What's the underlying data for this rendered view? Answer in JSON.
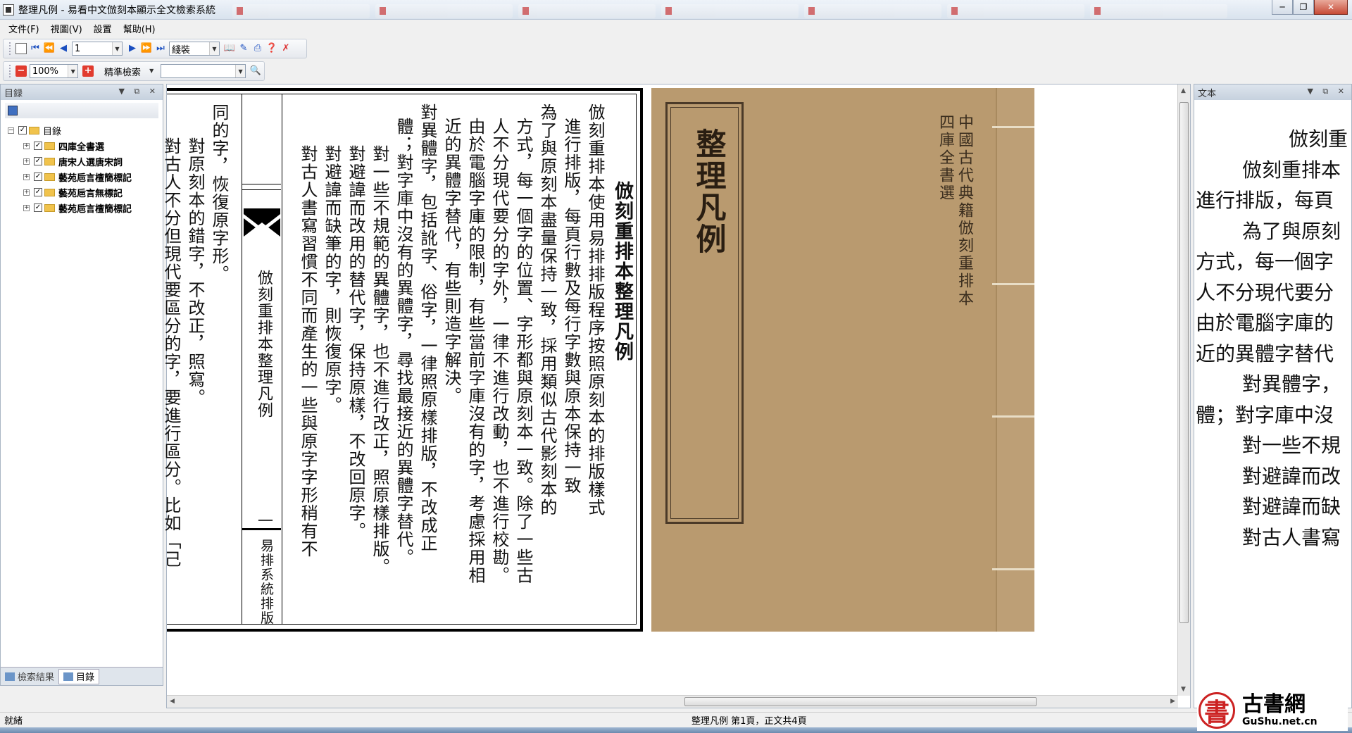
{
  "window": {
    "title": "整理凡例 - 易看中文倣刻本顯示全文檢索系統"
  },
  "menu": [
    "文件(F)",
    "視圖(V)",
    "設置",
    "幫助(H)"
  ],
  "toolbar": {
    "page_value": "1",
    "view_mode": "綫裝",
    "zoom": "100%",
    "search_mode": "精準檢索"
  },
  "left_panel": {
    "title": "目録",
    "tree": {
      "root": "目錄",
      "children": [
        "四庫全書選",
        "唐宋人選唐宋詞",
        "藝苑巵言檀簡標記",
        "藝苑巵言無標記",
        "藝苑巵言檀簡標記"
      ]
    },
    "tabs": [
      "檢索結果",
      "目錄"
    ]
  },
  "page": {
    "title": "倣刻重排本整理凡例",
    "columns": [
      "倣刻重排本使用易排排版程序按照原刻本的排版樣式",
      "進行排版，每頁行數及每行字數與原本保持一致",
      "為了與原刻本盡量保持一致，採用類似古代影刻本的",
      "方式，每一個字的位置、字形都與原刻本一致。除了一些古",
      "人不分現代要分的字外，一律不進行改動，也不進行校勘。",
      "由於電腦字庫的限制，有些當前字庫沒有的字，考慮採用相",
      "近的異體字替代，有些則造字解決。",
      "對異體字，包括訛字、俗字，一律照原樣排版，不改成正",
      "體；對字庫中沒有的異體字，尋找最接近的異體字替代。",
      "對一些不規範的異體字，也不進行改正，照原樣排版。",
      "對避諱而改用的替代字，保持原樣，不改回原字。",
      "對避諱而缺筆的字，則恢復原字。",
      "對古人書寫習慣不同而產生的一些與原字字形稍有不"
    ],
    "spine_title": "倣刻重排本整理凡例",
    "spine_number": "一",
    "spine_footer": "易排系統排版",
    "after_columns": [
      "同的字，恢復原字形。",
      "對原刻本的錯字，不改正，照寫。",
      "對古人不分但現代要區分的字，要進行區分。比如「己"
    ]
  },
  "cover": {
    "label": "整理凡例",
    "series": "中國古代典籍倣刻重排本",
    "collection": "四庫全書選"
  },
  "right_panel": {
    "title": "文本",
    "lines": [
      "倣刻重",
      "倣刻重排本",
      "進行排版，每頁",
      "為了與原刻",
      "方式，每一個字",
      "人不分現代要分",
      "由於電腦字庫的",
      "近的異體字替代",
      "對異體字，",
      "體；對字庫中沒",
      "對一些不規",
      "對避諱而改",
      "對避諱而缺",
      "對古人書寫"
    ]
  },
  "status": {
    "left": "就緒",
    "center": "整理凡例 第1頁，正文共4頁"
  },
  "logo": {
    "char": "書",
    "name": "古書網",
    "url": "GuShu.net.cn"
  }
}
